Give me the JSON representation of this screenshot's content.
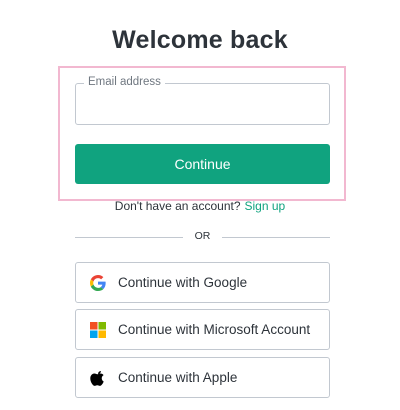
{
  "title": "Welcome back",
  "email": {
    "label": "Email address",
    "value": "",
    "placeholder": ""
  },
  "continue_label": "Continue",
  "signup": {
    "prompt": "Don't have an account?",
    "link": "Sign up"
  },
  "divider_text": "OR",
  "social": [
    {
      "label": "Continue with Google",
      "icon": "google-icon"
    },
    {
      "label": "Continue with Microsoft Account",
      "icon": "microsoft-icon"
    },
    {
      "label": "Continue with Apple",
      "icon": "apple-icon"
    }
  ],
  "colors": {
    "accent": "#10a37f",
    "highlight": "#f2b8d0",
    "text": "#2d333a",
    "border": "#c2c8d0"
  }
}
